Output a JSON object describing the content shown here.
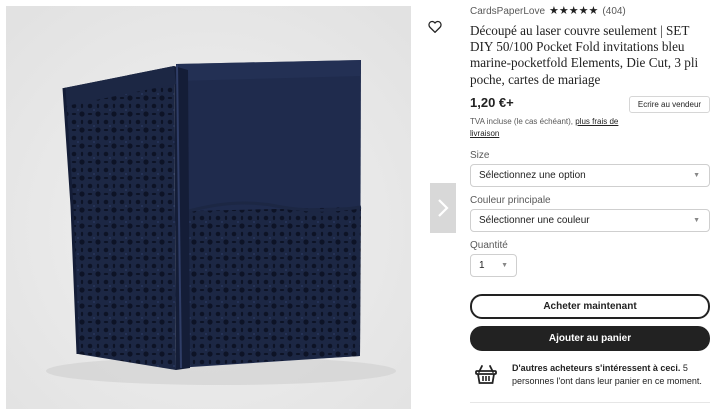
{
  "shop": {
    "name": "CardsPaperLove",
    "rating_stars": 5,
    "review_count": "(404)"
  },
  "product": {
    "title": "Découpé au laser couvre seulement | SET DIY 50/100 Pocket Fold invitations bleu marine-pocketfold Elements, Die Cut, 3 pli poche, cartes de mariage",
    "price": "1,20 €+",
    "tva_text": "TVA incluse (le cas échéant),",
    "shipping_link": "plus frais de livraison"
  },
  "contact_label": "Ecrire au vendeur",
  "size": {
    "label": "Size",
    "value": "Sélectionnez une option"
  },
  "color": {
    "label": "Couleur principale",
    "value": "Sélectionner une couleur"
  },
  "quantity": {
    "label": "Quantité",
    "value": "1"
  },
  "buy_now_label": "Acheter maintenant",
  "add_to_cart_label": "Ajouter au panier",
  "interest": {
    "bold": "D'autres acheteurs s'intéressent à ceci.",
    "rest": " 5 personnes l'ont dans leur panier en ce moment."
  },
  "icons": {
    "favorite": "heart-icon",
    "next": "chevron-right-icon",
    "basket": "basket-icon"
  },
  "colors": {
    "product_navy": "#1c2744",
    "button_dark": "#222222"
  }
}
